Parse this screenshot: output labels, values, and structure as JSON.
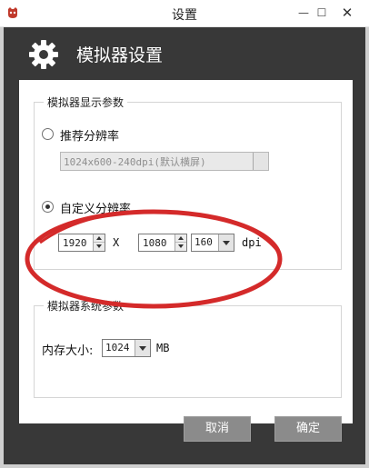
{
  "window": {
    "title": "设置",
    "minimize_glyph": "—",
    "maximize_glyph": "☐",
    "close_glyph": "✕"
  },
  "header": {
    "title": "模拟器设置"
  },
  "display_group": {
    "legend": "模拟器显示参数",
    "recommended": {
      "label": "推荐分辨率",
      "selected": false,
      "value": "1024x600-240dpi(默认横屏)"
    },
    "custom": {
      "label": "自定义分辨率",
      "selected": true,
      "width": "1920",
      "x_sep": "X",
      "height": "1080",
      "dpi_value": "160",
      "dpi_unit": "dpi"
    }
  },
  "system_group": {
    "legend": "模拟器系统参数",
    "memory_label": "内存大小:",
    "memory_value": "1024",
    "memory_unit": "MB"
  },
  "buttons": {
    "cancel": "取消",
    "ok": "确定"
  },
  "colors": {
    "dialog_bg": "#383838",
    "annotation": "#d42a2a"
  }
}
